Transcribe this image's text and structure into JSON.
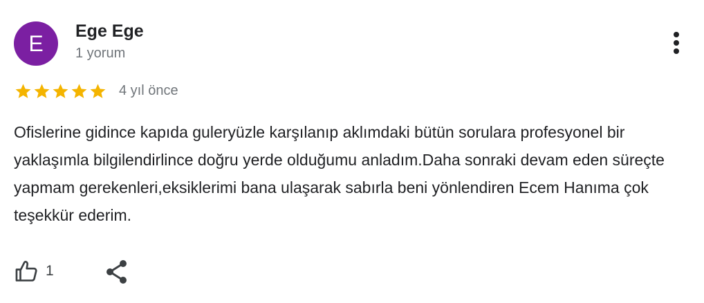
{
  "review": {
    "author": {
      "avatar_letter": "E",
      "avatar_color": "#7b1fa2",
      "name": "Ege Ege",
      "meta": "1 yorum"
    },
    "rating": {
      "stars": 5,
      "max_stars": 5,
      "star_color": "#f4b400"
    },
    "date": "4 yıl önce",
    "text": "Ofislerine gidince kapıda guleryüzle karşılanıp aklımdaki bütün sorulara profesyonel bir yaklaşımla bilgilendirlince doğru yerde olduğumu anladım.Daha sonraki devam eden süreçte yapmam gerekenleri,eksiklerimi bana ulaşarak sabırla beni yönlendiren Ecem Hanıma çok teşekkür ederim.",
    "actions": {
      "like_icon": "thumbs-up-icon",
      "like_count": "1",
      "share_icon": "share-icon",
      "more_icon": "more-vert-icon"
    }
  }
}
